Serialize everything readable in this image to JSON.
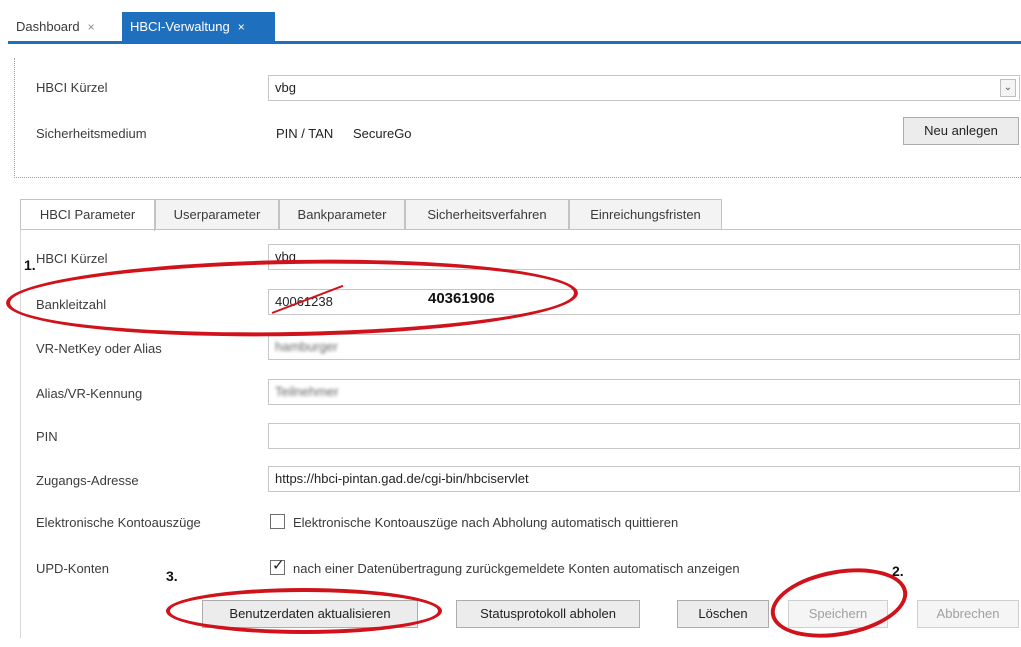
{
  "doc_tabs": [
    {
      "label": "Dashboard",
      "close": "×"
    },
    {
      "label": "HBCI-Verwaltung",
      "close": "×"
    }
  ],
  "top_panel": {
    "kuerzel_label": "HBCI Kürzel",
    "kuerzel_value": "vbg",
    "medium_label": "Sicherheitsmedium",
    "medium_value_1": "PIN / TAN",
    "medium_value_2": "SecureGo",
    "new_button": "Neu anlegen"
  },
  "sub_tabs": [
    "HBCI Parameter",
    "Userparameter",
    "Bankparameter",
    "Sicherheitsverfahren",
    "Einreichungsfristen"
  ],
  "form": {
    "kuerzel_label": "HBCI Kürzel",
    "kuerzel_value": "vbg",
    "blz_label": "Bankleitzahl",
    "blz_value": "40061238",
    "netkey_label": "VR-NetKey oder Alias",
    "netkey_value": "hamburger",
    "alias_label": "Alias/VR-Kennung",
    "alias_value": "Teilnehmer",
    "pin_label": "PIN",
    "pin_value": "",
    "address_label": "Zugangs-Adresse",
    "address_value": "https://hbci-pintan.gad.de/cgi-bin/hbciservlet",
    "ekonto_label": "Elektronische Kontoauszüge",
    "ekonto_checkbox_label": "Elektronische Kontoauszüge nach Abholung automatisch quittieren",
    "ekonto_checked": false,
    "upd_label": "UPD-Konten",
    "upd_checkbox_label": "nach einer Datenübertragung zurückgemeldete Konten automatisch anzeigen",
    "upd_checked": true
  },
  "buttons": {
    "refresh": "Benutzerdaten aktualisieren",
    "status": "Statusprotokoll abholen",
    "delete": "Löschen",
    "save": "Speichern",
    "cancel": "Abbrechen"
  },
  "annotations": {
    "step1": "1.",
    "step2": "2.",
    "step3": "3.",
    "new_blz": "40361906"
  },
  "colors": {
    "accent": "#1f6fbf",
    "annotation_red": "#d0121b"
  }
}
